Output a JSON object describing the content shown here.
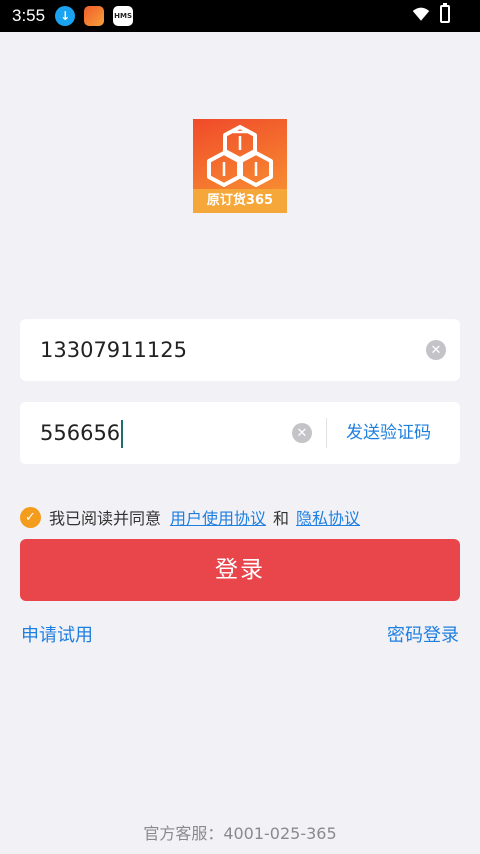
{
  "status_bar": {
    "time": "3:55",
    "icons": [
      "download-icon",
      "app-notification-icon",
      "hms-icon",
      "wifi-icon",
      "battery-charging-icon"
    ],
    "hms_label": "HMS"
  },
  "logo": {
    "label": "原订货365",
    "colors": [
      "#f04a2a",
      "#f89a33"
    ]
  },
  "phone_field": {
    "value": "13307911125",
    "clear_icon": "clear-icon"
  },
  "code_field": {
    "value": "556656",
    "clear_icon": "clear-icon",
    "send_label": "发送验证码"
  },
  "agreement": {
    "checked": true,
    "text": "我已阅读并同意",
    "terms_link": "用户使用协议",
    "and_text": "和",
    "privacy_link": "隐私协议"
  },
  "login_button": {
    "label": "登录",
    "color": "#e9464c"
  },
  "links": {
    "apply_trial": "申请试用",
    "password_login": "密码登录"
  },
  "footer": {
    "service": "官方客服：4001-025-365"
  },
  "colors": {
    "accent": "#1f7fe0",
    "check": "#f39c1e",
    "background": "#f2f2f6"
  }
}
